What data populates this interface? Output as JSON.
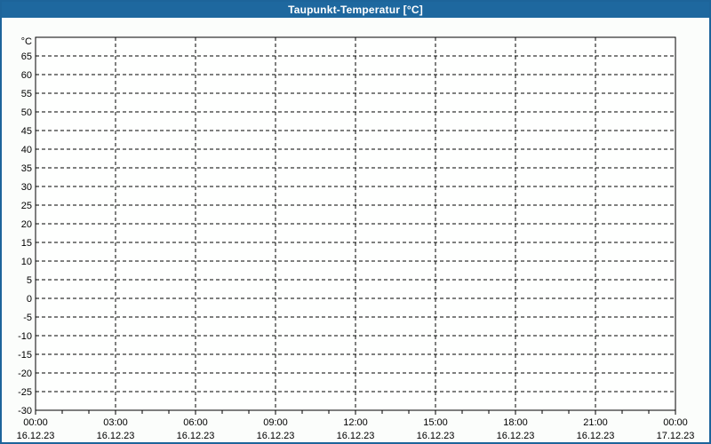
{
  "window": {
    "title": "Taupunkt-Temperatur [°C]"
  },
  "colors": {
    "titlebar": "#1e689f",
    "window_border": "#1d649a",
    "window_background": "#fbfdfb",
    "plot_background": "#fefffe",
    "axis": "#000000",
    "grid": "#000000",
    "title_text": "#ffffff",
    "tick_text": "#000000"
  },
  "chart_data": {
    "type": "line",
    "title": "Taupunkt-Temperatur [°C]",
    "xlabel": "",
    "ylabel": "°C",
    "ylim": [
      -30,
      70
    ],
    "y_tick_step": 5,
    "y_tick_labels": [
      "65",
      "60",
      "55",
      "50",
      "45",
      "40",
      "35",
      "30",
      "25",
      "20",
      "15",
      "10",
      "5",
      "0",
      "-5",
      "-10",
      "-15",
      "-20",
      "-25",
      "-30"
    ],
    "grid": "dashed",
    "legend": "none",
    "x_ticks": [
      {
        "time": "00:00",
        "date": "16.12.23"
      },
      {
        "time": "03:00",
        "date": "16.12.23"
      },
      {
        "time": "06:00",
        "date": "16.12.23"
      },
      {
        "time": "09:00",
        "date": "16.12.23"
      },
      {
        "time": "12:00",
        "date": "16.12.23"
      },
      {
        "time": "15:00",
        "date": "16.12.23"
      },
      {
        "time": "18:00",
        "date": "16.12.23"
      },
      {
        "time": "21:00",
        "date": "16.12.23"
      },
      {
        "time": "00:00",
        "date": "17.12.23"
      }
    ],
    "x_minor_ticks_per_interval": 3,
    "series": []
  }
}
